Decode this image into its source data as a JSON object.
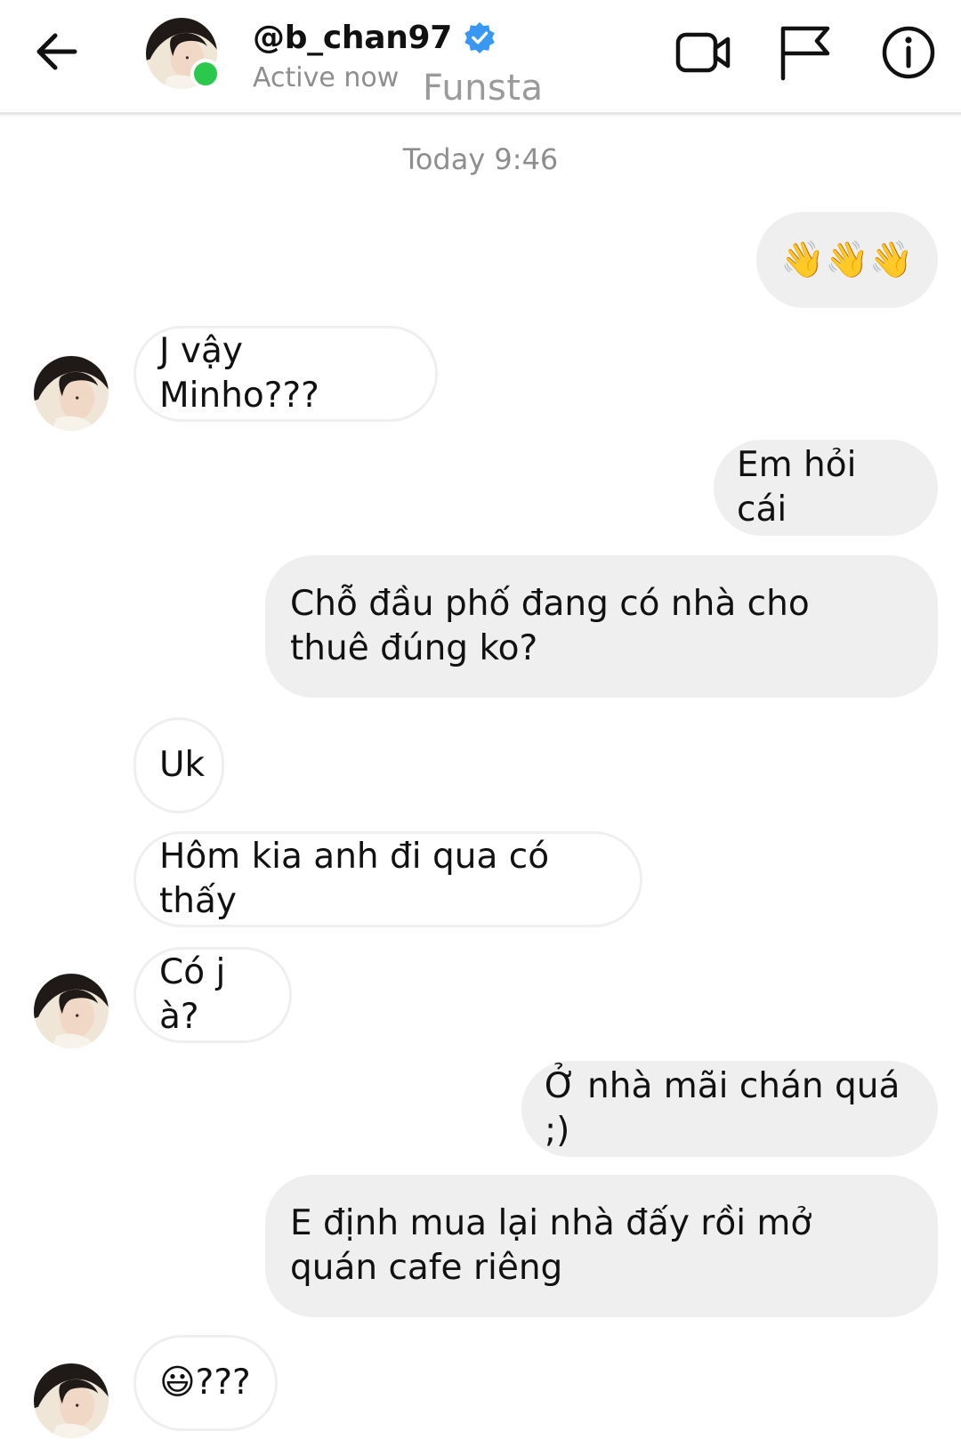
{
  "header": {
    "username": "@b_chan97",
    "status": "Active now",
    "account_tag": "Funsta",
    "icons": [
      "back-arrow-icon",
      "verified-badge-icon",
      "video-call-icon",
      "flag-icon",
      "info-icon"
    ]
  },
  "thread": {
    "timestamp": "Today 9:46",
    "messages": [
      {
        "sender": "me",
        "text": "👋👋👋"
      },
      {
        "sender": "them",
        "text": "J vậy Minho???"
      },
      {
        "sender": "me",
        "text": "Em hỏi cái"
      },
      {
        "sender": "me",
        "text": "Chỗ đầu phố đang có nhà cho thuê đúng ko?"
      },
      {
        "sender": "them",
        "text": "Uk"
      },
      {
        "sender": "them",
        "text": "Hôm kia anh đi qua có thấy"
      },
      {
        "sender": "them",
        "text": "Có j à?"
      },
      {
        "sender": "me",
        "text": "Ở nhà mãi chán quá ;)"
      },
      {
        "sender": "me",
        "text": "E định mua lại nhà đấy rồi mở quán cafe riêng"
      },
      {
        "sender": "them",
        "text": "😃???"
      }
    ]
  },
  "colors": {
    "online": "#2cc84d",
    "verified": "#3897f0",
    "outgoing_bubble": "#efefef",
    "incoming_border": "#efefef",
    "muted_text": "#8e8e8e"
  }
}
